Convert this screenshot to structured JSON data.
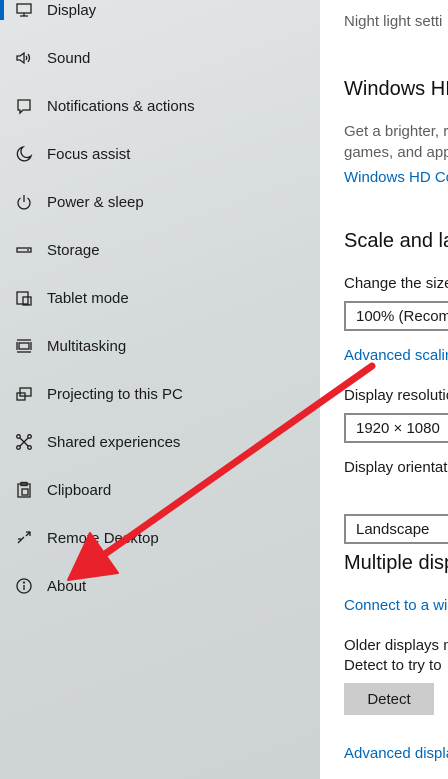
{
  "sidebar": {
    "items": [
      {
        "label": "Display",
        "icon": "display-icon"
      },
      {
        "label": "Sound",
        "icon": "speaker-icon"
      },
      {
        "label": "Notifications & actions",
        "icon": "notifications-icon"
      },
      {
        "label": "Focus assist",
        "icon": "moon-icon"
      },
      {
        "label": "Power & sleep",
        "icon": "power-icon"
      },
      {
        "label": "Storage",
        "icon": "storage-icon"
      },
      {
        "label": "Tablet mode",
        "icon": "tablet-icon"
      },
      {
        "label": "Multitasking",
        "icon": "multitasking-icon"
      },
      {
        "label": "Projecting to this PC",
        "icon": "projecting-icon"
      },
      {
        "label": "Shared experiences",
        "icon": "shared-experiences-icon"
      },
      {
        "label": "Clipboard",
        "icon": "clipboard-icon"
      },
      {
        "label": "Remote Desktop",
        "icon": "remote-desktop-icon"
      },
      {
        "label": "About",
        "icon": "info-icon"
      }
    ],
    "selected_index": 0
  },
  "main": {
    "night_light_text": "Night light setti",
    "hd_color": {
      "heading": "Windows HI",
      "desc_line1": "Get a brighter, r",
      "desc_line2": "games, and app",
      "link": "Windows HD Co"
    },
    "scale_layout": {
      "heading": "Scale and la",
      "change_size_label": "Change the size",
      "scale_value": "100% (Recomm",
      "advanced_scaling_link": "Advanced scalin",
      "resolution_label": "Display resolutio",
      "resolution_value": "1920 × 1080",
      "orientation_label": "Display orientat",
      "orientation_value": "Landscape"
    },
    "multiple_displays": {
      "heading": "Multiple disp",
      "connect_link": "Connect to a wi",
      "older_line1": "Older displays m",
      "older_line2": "Detect to try to",
      "detect_button": "Detect",
      "advanced_display_link": "Advanced displa"
    }
  },
  "colors": {
    "accent": "#0067c0",
    "link": "#0067b8",
    "annotation_arrow": "#e8212b"
  }
}
